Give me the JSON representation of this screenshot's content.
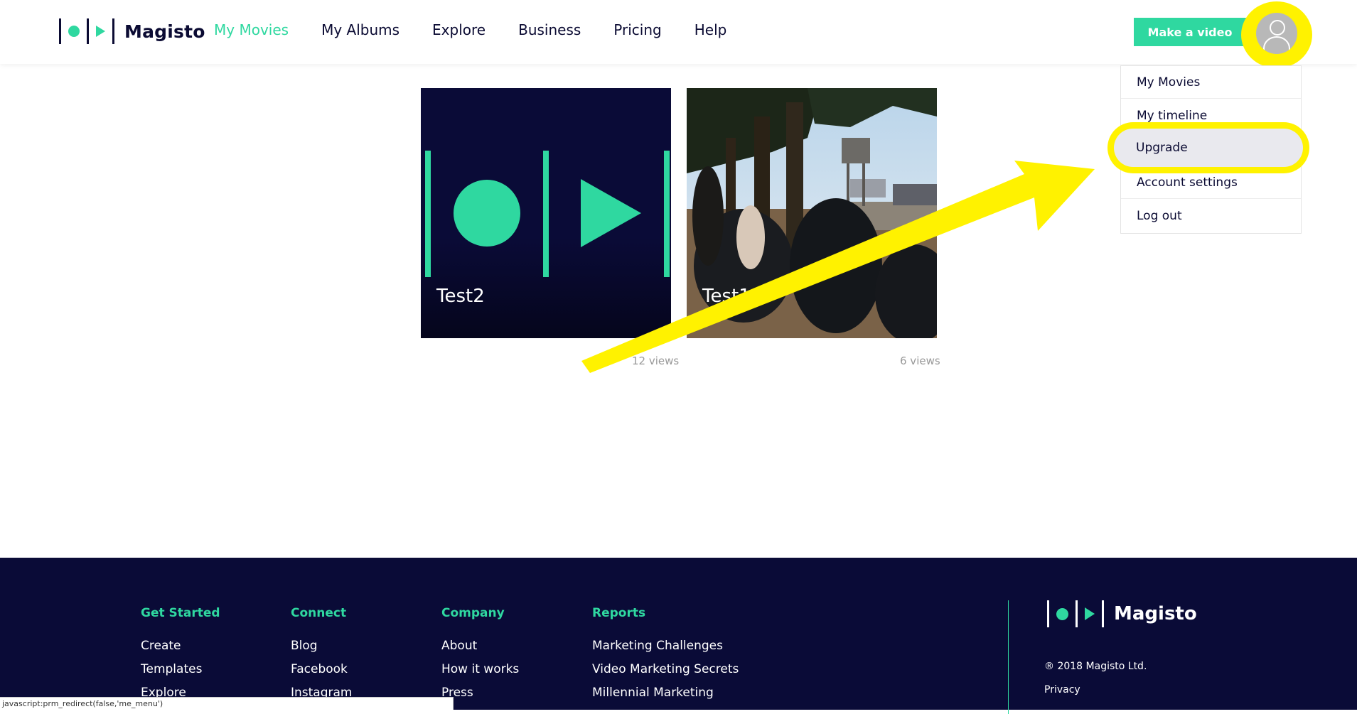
{
  "header": {
    "brand": "Magisto",
    "nav": [
      {
        "label": "My Movies",
        "active": true
      },
      {
        "label": "My Albums"
      },
      {
        "label": "Explore"
      },
      {
        "label": "Business"
      },
      {
        "label": "Pricing"
      },
      {
        "label": "Help"
      }
    ],
    "make_video_label": "Make a video",
    "avatar_icon": "user-avatar-icon"
  },
  "dropdown": {
    "items": [
      "My Movies",
      "My timeline",
      "Upgrade",
      "Account settings",
      "Log out"
    ]
  },
  "movies": [
    {
      "title": "Test2",
      "views": "12 views"
    },
    {
      "title": "Test1",
      "views": "6 views"
    }
  ],
  "footer": {
    "columns": [
      {
        "heading": "Get Started",
        "links": [
          "Create",
          "Templates",
          "Explore"
        ]
      },
      {
        "heading": "Connect",
        "links": [
          "Blog",
          "Facebook",
          "Instagram"
        ]
      },
      {
        "heading": "Company",
        "links": [
          "About",
          "How it works",
          "Press"
        ]
      },
      {
        "heading": "Reports",
        "links": [
          "Marketing Challenges",
          "Video Marketing Secrets",
          "Millennial Marketing"
        ]
      }
    ],
    "brand": "Magisto",
    "copyright": "® 2018 Magisto Ltd.",
    "privacy": "Privacy"
  },
  "status_bar": "javascript:prm_redirect(false,'me_menu')",
  "colors": {
    "accent": "#2fd8a0",
    "navy": "#0a0b37",
    "highlight": "#fff200"
  }
}
